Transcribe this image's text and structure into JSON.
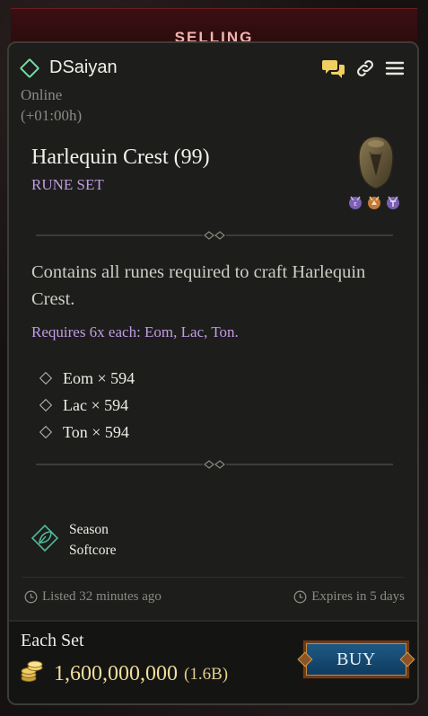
{
  "banner": {
    "label": "SELLING"
  },
  "seller": {
    "name": "DSaiyan",
    "status": "Online",
    "timezone": "(+01:00h)"
  },
  "item": {
    "title": "Harlequin Crest (99)",
    "type": "RUNE SET",
    "description": "Contains all runes required to craft Harlequin Crest.",
    "requirement": "Requires 6x each: Eom, Lac, Ton.",
    "runes": [
      {
        "label": "Eom × 594"
      },
      {
        "label": "Lac × 594"
      },
      {
        "label": "Ton × 594"
      }
    ]
  },
  "realm": {
    "season": "Season",
    "mode": "Softcore"
  },
  "meta": {
    "listed": "Listed 32 minutes ago",
    "expires": "Expires in 5 days"
  },
  "footer": {
    "unit_label": "Each Set",
    "price": "1,600,000,000",
    "price_short": "(1.6B)",
    "buy_label": "BUY"
  },
  "colors": {
    "online_indicator": "#6ee0a6",
    "item_type": "#c39be6",
    "price": "#f2df9a",
    "banner": "#3a0f12",
    "buy_button": "#1e5a86"
  },
  "icons": [
    "online-diamond-icon",
    "chat-icon",
    "link-icon",
    "menu-icon",
    "helm-icon",
    "rune-eom-icon",
    "rune-lac-icon",
    "rune-ton-icon",
    "season-leaf-icon",
    "clock-icon",
    "gold-coins-icon"
  ]
}
